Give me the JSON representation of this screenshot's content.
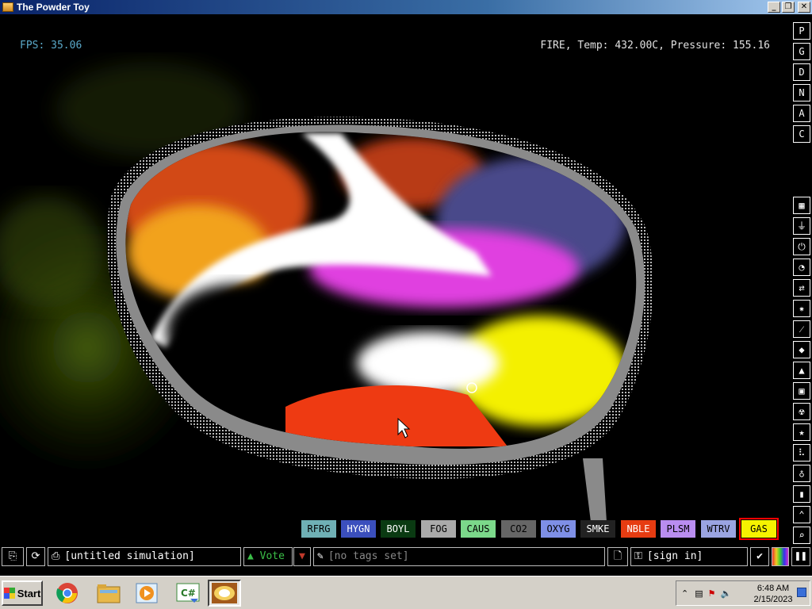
{
  "window": {
    "title": "The Powder Toy",
    "controls": [
      "_",
      "❐",
      "✕"
    ]
  },
  "sim": {
    "fps_label": "FPS: 35.06",
    "hud": "FIRE, Temp: 432.00C, Pressure: 155.16"
  },
  "right_menu": {
    "top_buttons": [
      "P",
      "G",
      "D",
      "N",
      "A",
      "C"
    ],
    "categories": [
      "walls-icon",
      "electronics-icon",
      "powered-icon",
      "sensors-icon",
      "force-icon",
      "explosives-icon",
      "gases-icon",
      "liquids-icon",
      "powders-icon",
      "solids-icon",
      "radioactive-icon",
      "special-icon",
      "game-of-life-icon",
      "tools-icon",
      "favorites-icon",
      "decoration-icon",
      "search-icon"
    ]
  },
  "elements": [
    {
      "label": "RFRG",
      "bg": "#6fb0b5",
      "fg": "#000000"
    },
    {
      "label": "HYGN",
      "bg": "#3b4fbd",
      "fg": "#ffffff"
    },
    {
      "label": "BOYL",
      "bg": "#0a3a12",
      "fg": "#ffffff"
    },
    {
      "label": "FOG",
      "bg": "#aaaaaa",
      "fg": "#000000"
    },
    {
      "label": "CAUS",
      "bg": "#7bd88a",
      "fg": "#000000"
    },
    {
      "label": "CO2",
      "bg": "#666666",
      "fg": "#000000"
    },
    {
      "label": "OXYG",
      "bg": "#7e8fe6",
      "fg": "#000000"
    },
    {
      "label": "SMKE",
      "bg": "#222222",
      "fg": "#ffffff"
    },
    {
      "label": "NBLE",
      "bg": "#e63c12",
      "fg": "#ffffff"
    },
    {
      "label": "PLSM",
      "bg": "#b98df0",
      "fg": "#000000"
    },
    {
      "label": "WTRV",
      "bg": "#9aa4e2",
      "fg": "#000000"
    },
    {
      "label": "GAS",
      "bg": "#f6f200",
      "fg": "#000000",
      "selected": true
    }
  ],
  "bottom_bar": {
    "save_name": "[untitled simulation]",
    "vote": "Vote",
    "tags": "[no tags set]",
    "sign_in": "[sign in]",
    "pause": "❚❚"
  },
  "taskbar": {
    "start": "Start",
    "apps": [
      "chrome",
      "explorer",
      "media-player",
      "csharp-editor",
      "powder-toy"
    ],
    "time": "6:48 AM",
    "date": "2/15/2023"
  },
  "colors": {
    "fps": "#5aa9c9",
    "vote_green": "#3bbf48",
    "selected_outline": "#ff0000"
  }
}
